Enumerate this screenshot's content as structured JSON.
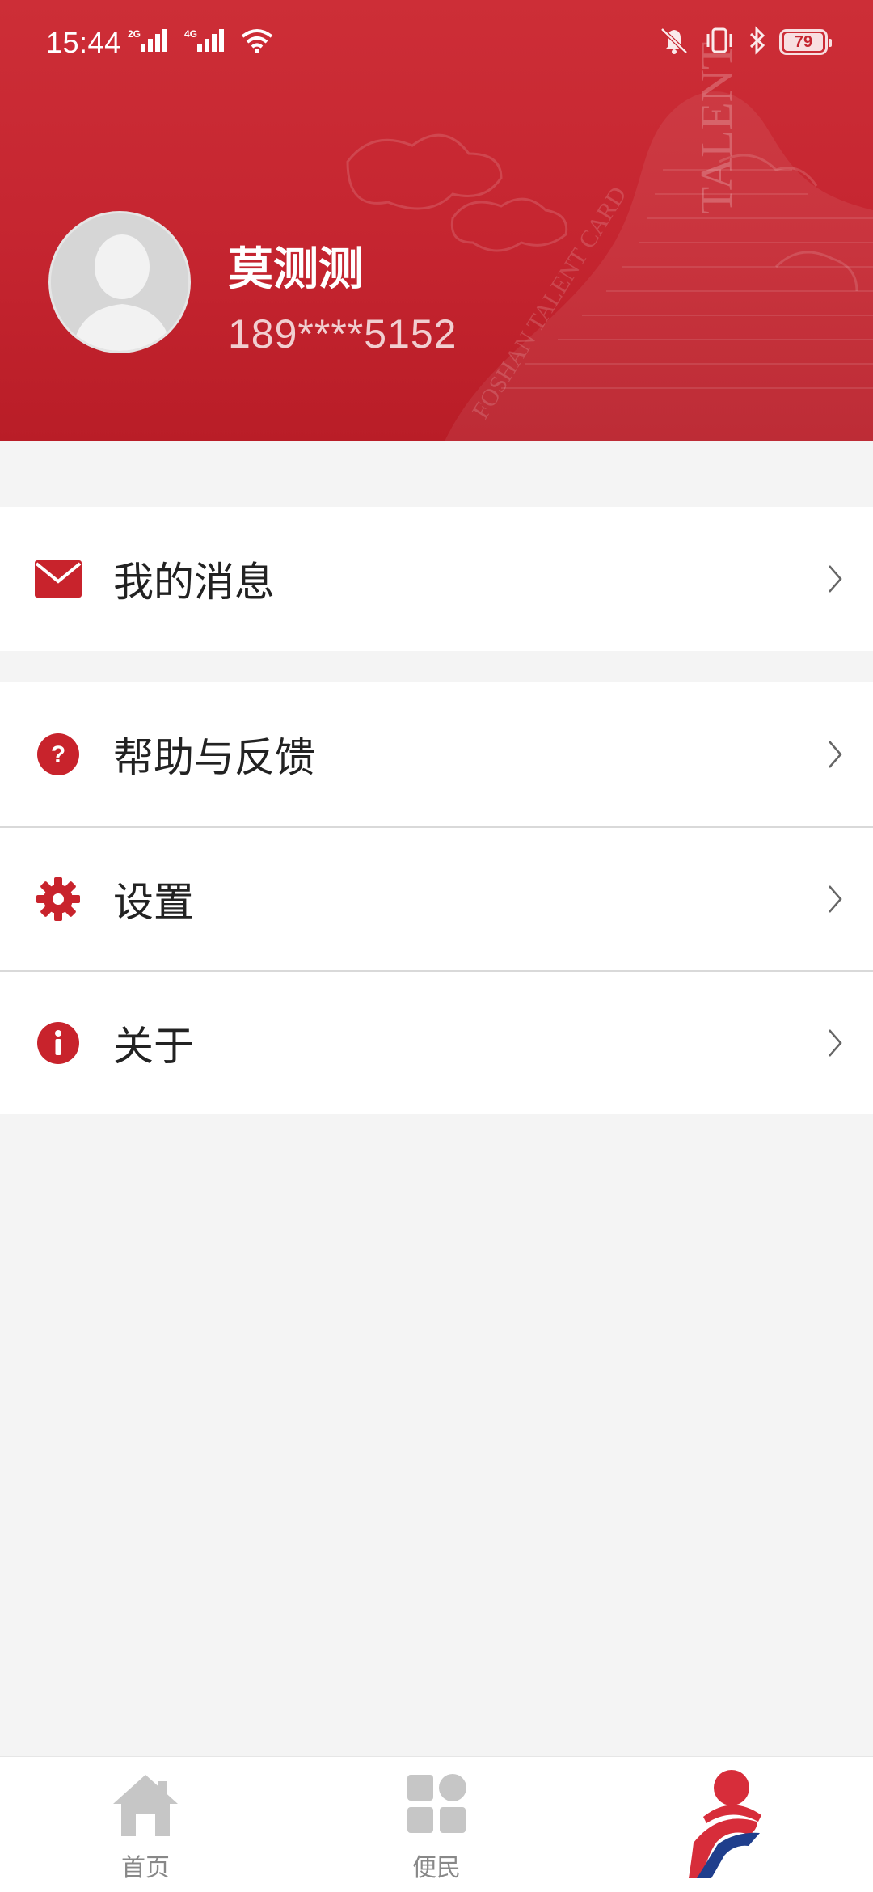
{
  "status_bar": {
    "time": "15:44",
    "network_1": "2G",
    "network_2": "4G",
    "battery": "79",
    "icons": [
      "signal-icon",
      "signal-icon",
      "wifi-icon",
      "mute-icon",
      "vibrate-icon",
      "bluetooth-icon",
      "battery-icon"
    ]
  },
  "header": {
    "user_name": "莫测测",
    "phone": "189****5152",
    "background_watermark": "FOSHAN TALENT CARD",
    "background_color": "#c52530"
  },
  "menu": {
    "group1": [
      {
        "label": "我的消息",
        "icon": "mail-icon"
      }
    ],
    "group2": [
      {
        "label": "帮助与反馈",
        "icon": "question-icon"
      },
      {
        "label": "设置",
        "icon": "gear-icon"
      },
      {
        "label": "关于",
        "icon": "info-icon"
      }
    ],
    "accent_color": "#c8232c"
  },
  "bottom_nav": {
    "items": [
      {
        "label": "首页",
        "icon": "home-icon",
        "active": false
      },
      {
        "label": "便民",
        "icon": "grid-icon",
        "active": false
      },
      {
        "label": "",
        "icon": "profile-logo-icon",
        "active": true
      }
    ]
  }
}
